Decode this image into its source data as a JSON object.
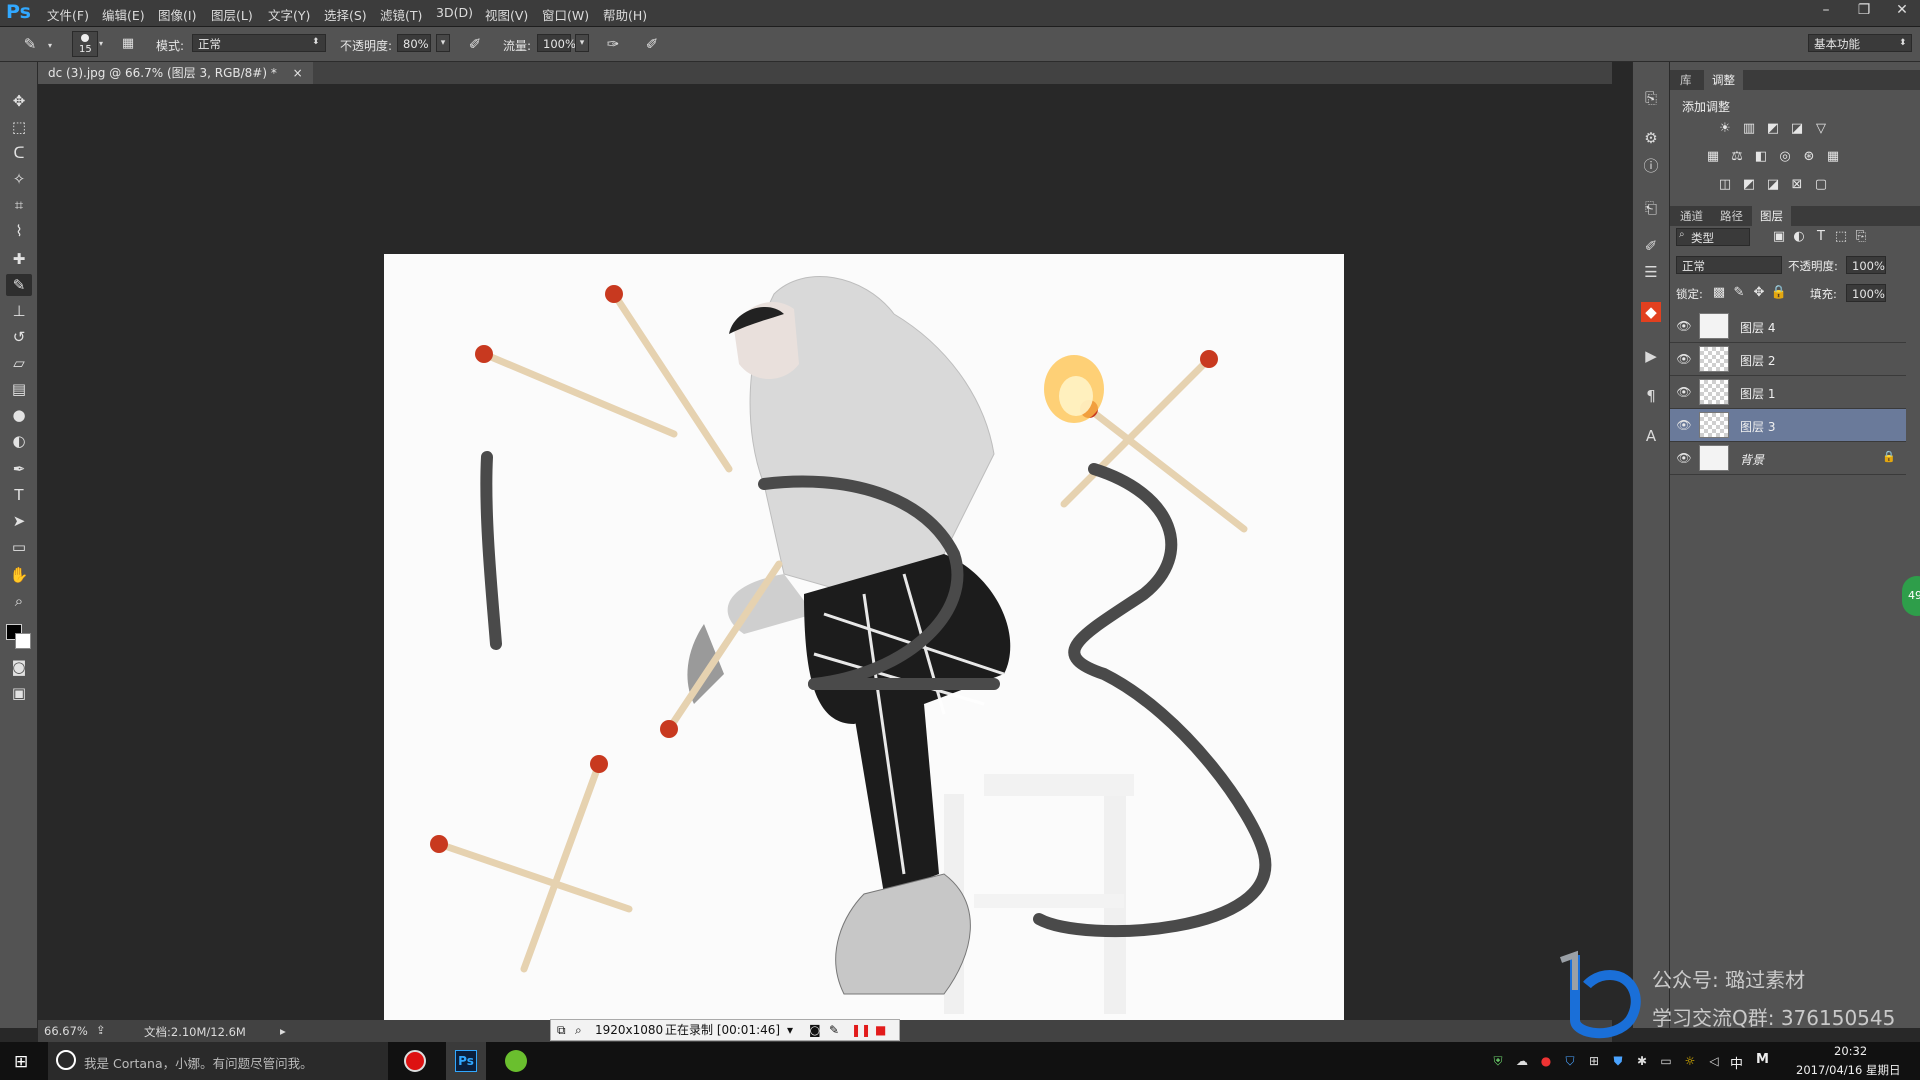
{
  "app": {
    "logo": "Ps"
  },
  "menu": [
    "文件(F)",
    "编辑(E)",
    "图像(I)",
    "图层(L)",
    "文字(Y)",
    "选择(S)",
    "滤镜(T)",
    "3D(D)",
    "视图(V)",
    "窗口(W)",
    "帮助(H)"
  ],
  "window_controls": {
    "minimize": "–",
    "restore": "❐",
    "close": "✕"
  },
  "options": {
    "brush_size": "15",
    "mode_label": "模式:",
    "mode_value": "正常",
    "opacity_label": "不透明度:",
    "opacity_value": "80%",
    "flow_label": "流量:",
    "flow_value": "100%",
    "workspace": "基本功能"
  },
  "document_tab": {
    "title": "dc (3).jpg @ 66.7% (图层 3, RGB/8#) *",
    "close": "×"
  },
  "status": {
    "zoom": "66.67%",
    "doc_size": "文档:2.10M/12.6M"
  },
  "recorder": {
    "resolution": "1920x1080",
    "recording": "正在录制 [00:01:46]"
  },
  "panels": {
    "top_tabs": [
      "库",
      "调整"
    ],
    "adjust_title": "添加调整",
    "layer_tabs": [
      "通道",
      "路径",
      "图层"
    ],
    "filter_kind": "类型",
    "blend_mode": "正常",
    "opacity_label": "不透明度:",
    "opacity_value": "100%",
    "lock_label": "锁定:",
    "fill_label": "填充:",
    "fill_value": "100%"
  },
  "layers": [
    {
      "name": "图层 4",
      "selected": false,
      "visible": true,
      "thumb": "photo"
    },
    {
      "name": "图层 2",
      "selected": false,
      "visible": true,
      "thumb": "transparent"
    },
    {
      "name": "图层 1",
      "selected": false,
      "visible": true,
      "thumb": "transparent"
    },
    {
      "name": "图层 3",
      "selected": true,
      "visible": true,
      "thumb": "transparent"
    },
    {
      "name": "背景",
      "selected": false,
      "visible": true,
      "thumb": "photo",
      "locked": true
    }
  ],
  "watermark": {
    "line1": "公众号:  璐过素材",
    "line2": "学习交流Q群:  376150545"
  },
  "side_badge": "49",
  "taskbar": {
    "cortana_text": "我是 Cortana，小娜。有问题尽管问我。",
    "ps_label": "Ps",
    "ime": "中",
    "time": "20:32",
    "date": "2017/04/16 星期日"
  }
}
